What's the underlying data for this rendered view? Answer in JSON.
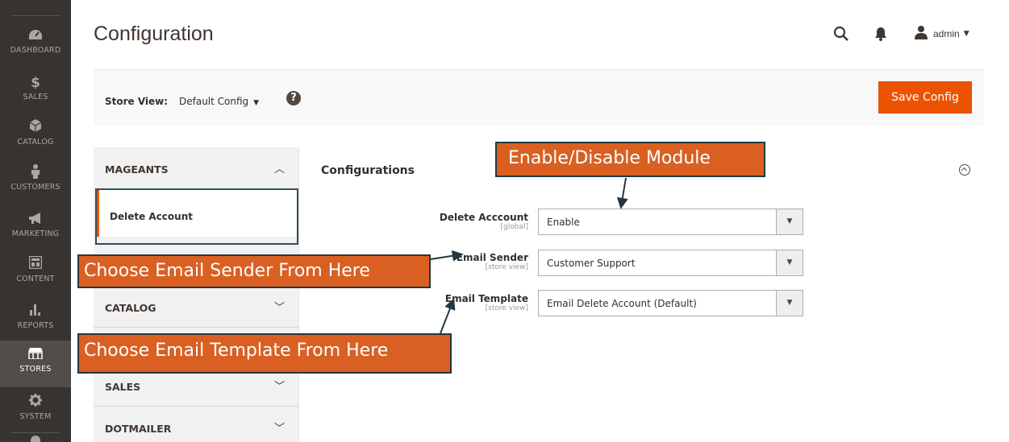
{
  "nav": {
    "items": [
      {
        "label": "DASHBOARD",
        "icon": "dashboard-icon"
      },
      {
        "label": "SALES",
        "icon": "dollar-icon"
      },
      {
        "label": "CATALOG",
        "icon": "box-icon"
      },
      {
        "label": "CUSTOMERS",
        "icon": "person-icon"
      },
      {
        "label": "MARKETING",
        "icon": "megaphone-icon"
      },
      {
        "label": "CONTENT",
        "icon": "layout-icon"
      },
      {
        "label": "REPORTS",
        "icon": "bar-chart-icon"
      },
      {
        "label": "STORES",
        "icon": "store-icon"
      },
      {
        "label": "SYSTEM",
        "icon": "gear-icon"
      }
    ]
  },
  "header": {
    "title": "Configuration",
    "user": "admin"
  },
  "store_bar": {
    "label": "Store View:",
    "selected": "Default Config",
    "help": "?",
    "save_label": "Save Config"
  },
  "tabs": {
    "mageants": "MAGEANTS",
    "delete_account": "Delete Account",
    "catalog": "CATALOG",
    "sales": "SALES",
    "dotmailer": "DOTMAILER"
  },
  "section": {
    "title": "Configurations",
    "fields": [
      {
        "label": "Delete Acccount",
        "scope": "[global]",
        "value": "Enable"
      },
      {
        "label": "Email Sender",
        "scope": "[store view]",
        "value": "Customer Support"
      },
      {
        "label": "Email Template",
        "scope": "[store view]",
        "value": "Email Delete Account (Default)"
      }
    ]
  },
  "callouts": {
    "module": "Enable/Disable Module",
    "sender": "Choose Email Sender From Here",
    "template": "Choose Email Template From Here"
  },
  "colors": {
    "nav_bg": "#373330",
    "accent": "#eb5202",
    "callout_bg": "#d96022",
    "callout_border": "#233840"
  }
}
